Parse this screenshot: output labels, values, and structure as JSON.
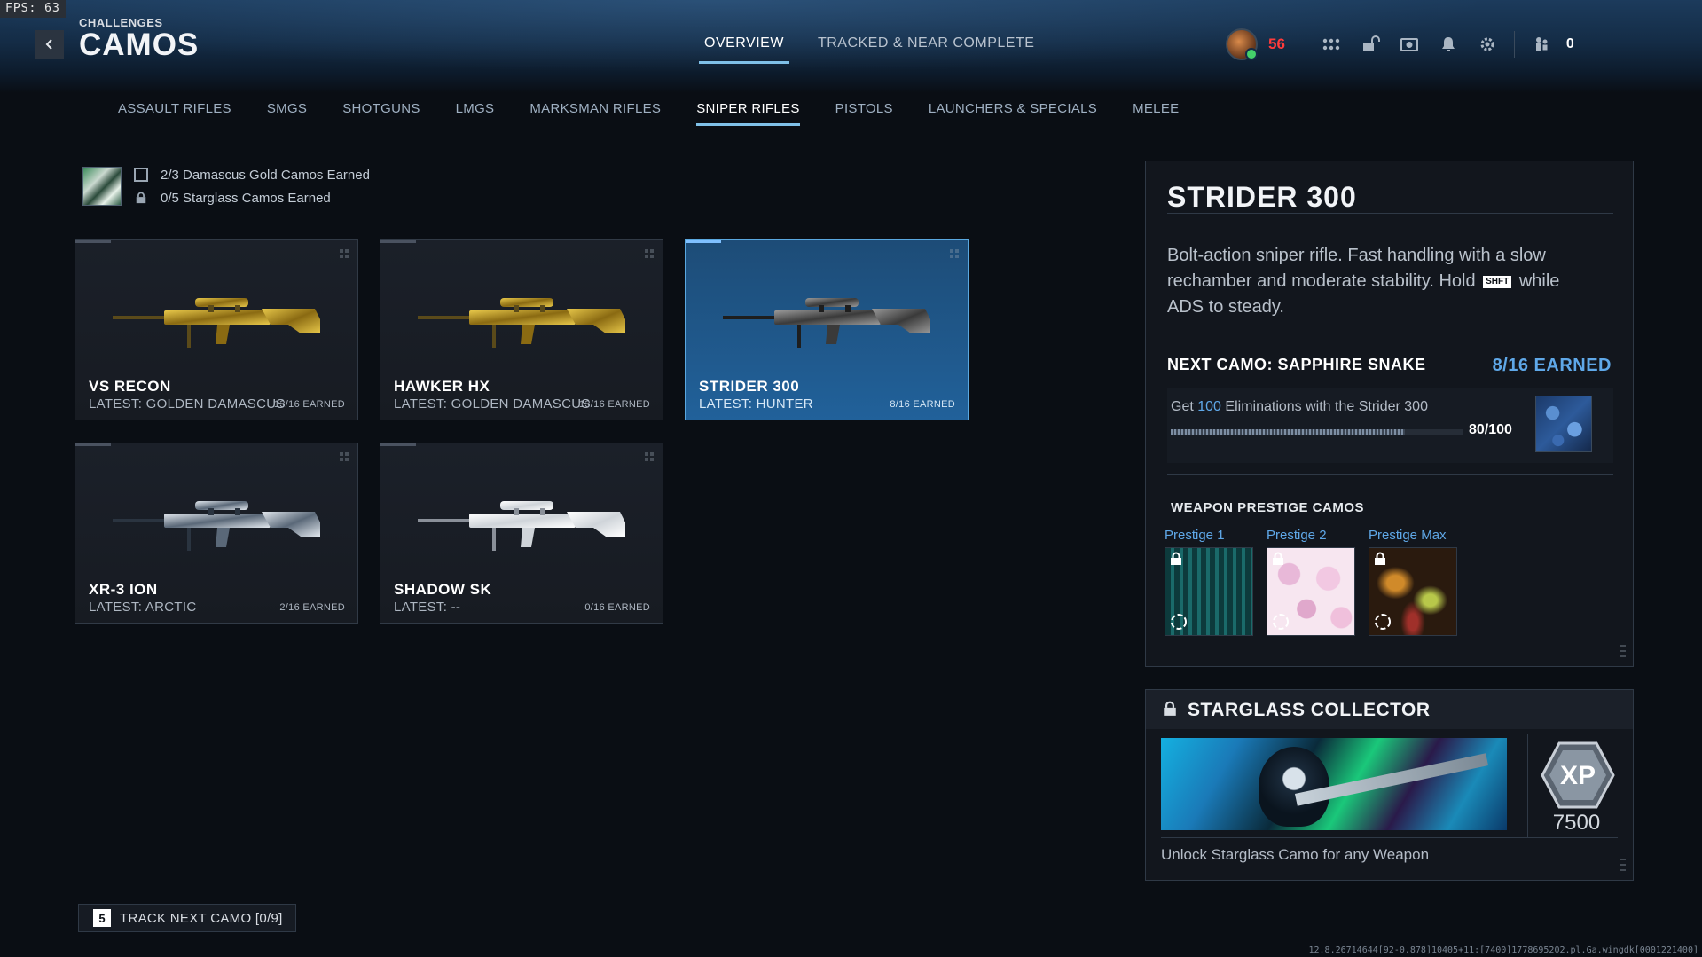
{
  "fps": "FPS:   63",
  "header": {
    "breadcrumb": "CHALLENGES",
    "title": "CAMOS",
    "tabs": [
      {
        "label": "OVERVIEW",
        "active": true
      },
      {
        "label": "TRACKED & NEAR COMPLETE",
        "active": false
      }
    ],
    "player_level": "56",
    "party_count": "0"
  },
  "categories": [
    {
      "label": "ASSAULT RIFLES",
      "active": false
    },
    {
      "label": "SMGS",
      "active": false
    },
    {
      "label": "SHOTGUNS",
      "active": false
    },
    {
      "label": "LMGS",
      "active": false
    },
    {
      "label": "MARKSMAN RIFLES",
      "active": false
    },
    {
      "label": "SNIPER RIFLES",
      "active": true
    },
    {
      "label": "PISTOLS",
      "active": false
    },
    {
      "label": "LAUNCHERS & SPECIALS",
      "active": false
    },
    {
      "label": "MELEE",
      "active": false
    }
  ],
  "summary": {
    "damascus": "2/3 Damascus Gold Camos Earned",
    "starglass": "0/5 Starglass Camos Earned"
  },
  "weapons": [
    {
      "name": "VS RECON",
      "latest": "LATEST: GOLDEN DAMASCUS",
      "earned": "13/16 EARNED",
      "selected": false,
      "finish": "gold"
    },
    {
      "name": "HAWKER HX",
      "latest": "LATEST: GOLDEN DAMASCUS",
      "earned": "13/16 EARNED",
      "selected": false,
      "finish": "gold"
    },
    {
      "name": "STRIDER 300",
      "latest": "LATEST: HUNTER",
      "earned": "8/16 EARNED",
      "selected": true,
      "finish": "hunter"
    },
    {
      "name": "XR-3 ION",
      "latest": "LATEST: ARCTIC",
      "earned": "2/16 EARNED",
      "selected": false,
      "finish": "arctic"
    },
    {
      "name": "SHADOW SK",
      "latest": "LATEST: --",
      "earned": "0/16 EARNED",
      "selected": false,
      "finish": "white"
    }
  ],
  "detail": {
    "title": "STRIDER 300",
    "desc_part1": "Bolt-action sniper rifle. Fast handling with a slow rechamber and moderate stability. Hold",
    "key": "SHFT",
    "desc_part2": "while ADS to steady.",
    "next_camo_label": "NEXT CAMO: SAPPHIRE SNAKE",
    "next_camo_earned": "8/16 EARNED",
    "challenge_prefix": "Get",
    "challenge_highlight": "100",
    "challenge_suffix": "Eliminations with the Strider 300",
    "challenge_count": "80/100",
    "challenge_progress": 0.8,
    "prestige_title": "WEAPON PRESTIGE CAMOS",
    "prestige": [
      "Prestige 1",
      "Prestige 2",
      "Prestige Max"
    ]
  },
  "starglass": {
    "title": "STARGLASS COLLECTOR",
    "xp": "7500",
    "desc": "Unlock Starglass Camo for any Weapon"
  },
  "track": {
    "key": "5",
    "label": "TRACK NEXT CAMO [0/9]"
  },
  "build_info": "12.8.26714644[92-0.878]10405+11:[7400]1778695202.pl.Ga.wingdk[0001221400]",
  "colors": {
    "accent_blue": "#5fa8e8",
    "level_red": "#ff3b3b",
    "selected_card": "#21619a"
  }
}
